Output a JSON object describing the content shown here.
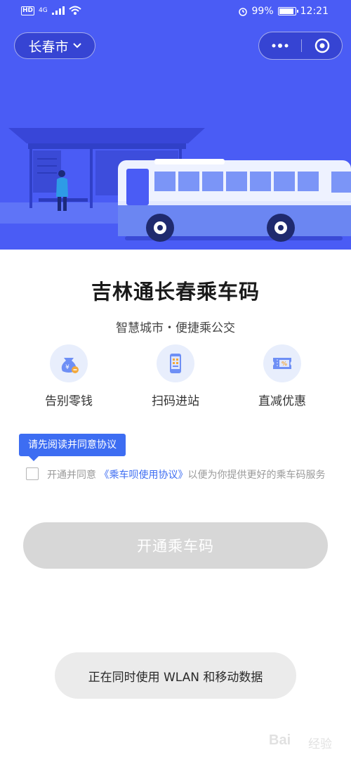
{
  "status_bar": {
    "hd": "HD",
    "network": "4G",
    "battery": "99%",
    "battery_level": 0.99,
    "time": "12:21"
  },
  "nav": {
    "city": "长春市"
  },
  "header": {
    "title": "吉林通长春乘车码",
    "subtitle": "智慧城市・便捷乘公交"
  },
  "features": [
    {
      "label": "告别零钱",
      "icon": "money-bag-icon"
    },
    {
      "label": "扫码进站",
      "icon": "phone-scan-icon"
    },
    {
      "label": "直减优惠",
      "icon": "discount-ticket-icon"
    }
  ],
  "agreement": {
    "tooltip": "请先阅读并同意协议",
    "prefix": "开通并同意",
    "link": "《乘车呗使用协议》",
    "suffix": "以便为你提供更好的乘车码服务",
    "checked": false
  },
  "action": {
    "open_label": "开通乘车码",
    "enabled": false
  },
  "toast": {
    "message": "正在同时使用 WLAN 和移动数据"
  },
  "watermark": {
    "text": "Bai",
    "sub": "经验"
  },
  "colors": {
    "hero_blue": "#4a5cf5",
    "accent": "#3d6df2",
    "disabled_button": "#d7d7d7"
  }
}
